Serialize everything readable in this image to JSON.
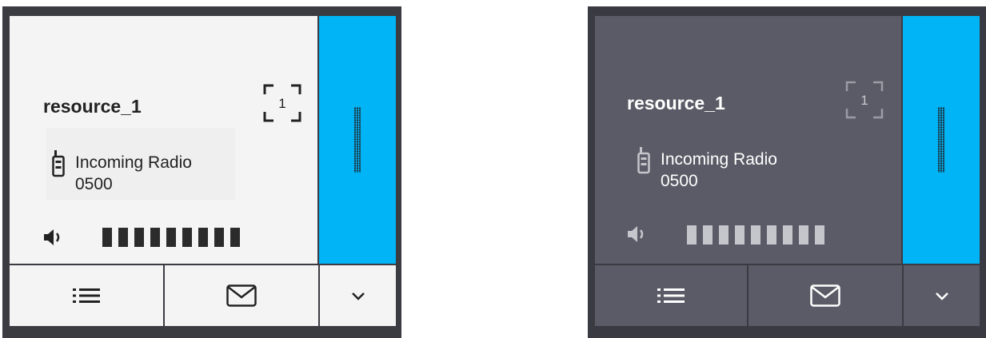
{
  "cards": [
    {
      "theme": "light",
      "resource_name": "resource_1",
      "slot_number": "1",
      "radio_status_line1": "Incoming Radio",
      "radio_status_line2": "0500",
      "volume_bars": 9,
      "icons": {
        "slot": "slot-frame-icon",
        "radio": "radio-icon",
        "speaker": "speaker-icon",
        "list": "list-icon",
        "message": "envelope-icon",
        "more": "chevron-down-icon"
      }
    },
    {
      "theme": "dark",
      "resource_name": "resource_1",
      "slot_number": "1",
      "radio_status_line1": "Incoming Radio",
      "radio_status_line2": "0500",
      "volume_bars": 9,
      "icons": {
        "slot": "slot-frame-icon",
        "radio": "radio-icon",
        "speaker": "speaker-icon",
        "list": "list-icon",
        "message": "envelope-icon",
        "more": "chevron-down-icon"
      }
    }
  ],
  "colors": {
    "accent_strip": "#00b4f5",
    "light_panel": "#f4f4f4",
    "dark_panel": "#5a5b66",
    "frame": "#3b3b42"
  }
}
